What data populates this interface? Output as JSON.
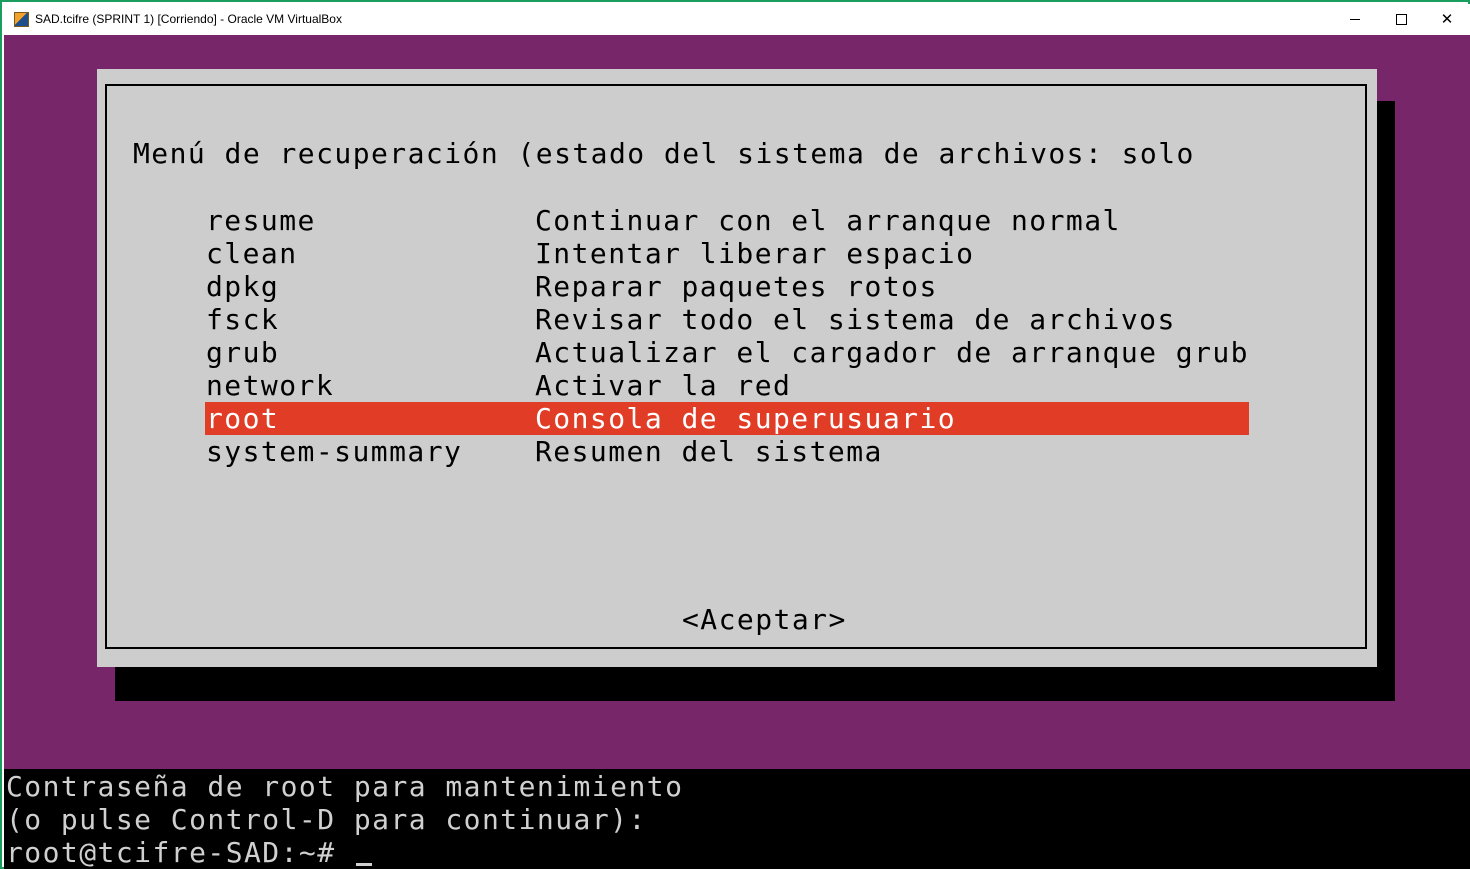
{
  "window": {
    "title": "SAD.tcifre (SPRINT 1) [Corriendo] - Oracle VM VirtualBox",
    "icon": "virtualbox-icon",
    "controls": {
      "minimize": "minimize-icon",
      "maximize": "maximize-icon",
      "close": "✕"
    }
  },
  "dialog": {
    "title": "Menú de recuperación (estado del sistema de archivos: solo",
    "items": [
      {
        "name": "resume",
        "description": "Continuar con el arranque normal"
      },
      {
        "name": "clean",
        "description": "Intentar liberar espacio"
      },
      {
        "name": "dpkg",
        "description": "Reparar paquetes rotos"
      },
      {
        "name": "fsck",
        "description": "Revisar todo el sistema de archivos"
      },
      {
        "name": "grub",
        "description": "Actualizar el cargador de arranque grub"
      },
      {
        "name": "network",
        "description": "Activar la red"
      },
      {
        "name": "root",
        "description": "Consola de superusuario",
        "selected": true
      },
      {
        "name": "system-summary",
        "description": "Resumen del sistema"
      }
    ],
    "accept_label": "<Aceptar>"
  },
  "console": {
    "line1": "Contraseña de root para mantenimiento",
    "line2": "(o pulse Control-D para continuar):",
    "prompt": "root@tcifre-SAD:~# "
  },
  "colors": {
    "desktop": "#772669",
    "dialog": "#cdcdcd",
    "selection": "#e03c26",
    "window_border": "#1a9e5f"
  }
}
